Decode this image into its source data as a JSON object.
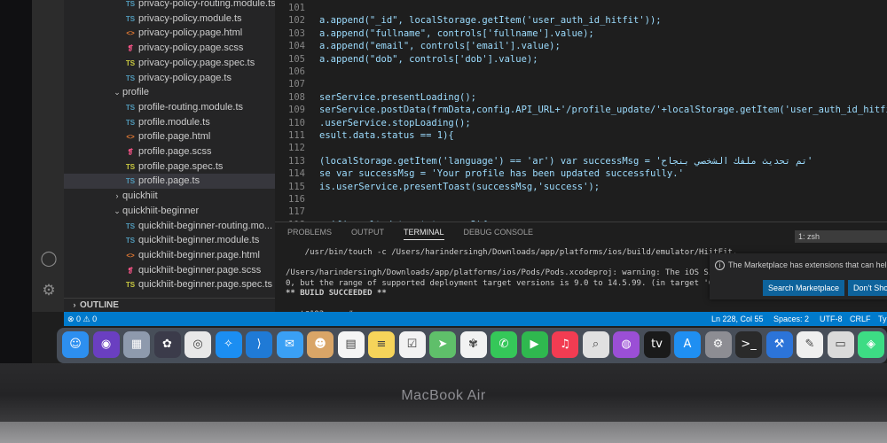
{
  "sidebar": {
    "items": [
      {
        "label": "privacy-policy-routing.module.ts",
        "icon": "TS",
        "type": "ts"
      },
      {
        "label": "privacy-policy.module.ts",
        "icon": "TS",
        "type": "ts"
      },
      {
        "label": "privacy-policy.page.html",
        "icon": "<>",
        "type": "html"
      },
      {
        "label": "privacy-policy.page.scss",
        "icon": "❡",
        "type": "scss"
      },
      {
        "label": "privacy-policy.page.spec.ts",
        "icon": "TS",
        "type": "spec"
      },
      {
        "label": "privacy-policy.page.ts",
        "icon": "TS",
        "type": "ts"
      },
      {
        "label": "profile",
        "icon": "⌄",
        "type": "folder-open"
      },
      {
        "label": "profile-routing.module.ts",
        "icon": "TS",
        "type": "ts"
      },
      {
        "label": "profile.module.ts",
        "icon": "TS",
        "type": "ts"
      },
      {
        "label": "profile.page.html",
        "icon": "<>",
        "type": "html"
      },
      {
        "label": "profile.page.scss",
        "icon": "❡",
        "type": "scss"
      },
      {
        "label": "profile.page.spec.ts",
        "icon": "TS",
        "type": "spec"
      },
      {
        "label": "profile.page.ts",
        "icon": "TS",
        "type": "ts",
        "selected": true
      },
      {
        "label": "quickhiit",
        "icon": "›",
        "type": "folder"
      },
      {
        "label": "quickhiit-beginner",
        "icon": "⌄",
        "type": "folder-open"
      },
      {
        "label": "quickhiit-beginner-routing.mo...",
        "icon": "TS",
        "type": "ts"
      },
      {
        "label": "quickhiit-beginner.module.ts",
        "icon": "TS",
        "type": "ts"
      },
      {
        "label": "quickhiit-beginner.page.html",
        "icon": "<>",
        "type": "html"
      },
      {
        "label": "quickhiit-beginner.page.scss",
        "icon": "❡",
        "type": "scss"
      },
      {
        "label": "quickhiit-beginner.page.spec.ts",
        "icon": "TS",
        "type": "spec"
      }
    ],
    "outline_label": "OUTLINE"
  },
  "editor": {
    "lines": [
      {
        "num": "101",
        "text": ""
      },
      {
        "num": "102",
        "text": "a.append(\"_id\", localStorage.getItem('user_auth_id_hitfit'));"
      },
      {
        "num": "103",
        "text": "a.append(\"fullname\", controls['fullname'].value);"
      },
      {
        "num": "104",
        "text": "a.append(\"email\", controls['email'].value);"
      },
      {
        "num": "105",
        "text": "a.append(\"dob\", controls['dob'].value);"
      },
      {
        "num": "106",
        "text": ""
      },
      {
        "num": "107",
        "text": ""
      },
      {
        "num": "108",
        "text": "serService.presentLoading();"
      },
      {
        "num": "109",
        "text": "serService.postData(frmData,config.API_URL+'/profile_update/'+localStorage.getItem('user_auth_id_hitfit')).subscribe((result) => {"
      },
      {
        "num": "110",
        "text": ".userService.stopLoading();"
      },
      {
        "num": "111",
        "text": "esult.data.status == 1){"
      },
      {
        "num": "112",
        "text": ""
      },
      {
        "num": "113",
        "text": "(localStorage.getItem('language') == 'ar') var successMsg = 'تم تحديث ملفك الشخصي بنجاح'"
      },
      {
        "num": "114",
        "text": "se var successMsg = 'Your profile has been updated successfully.'"
      },
      {
        "num": "115",
        "text": "is.userService.presentToast(successMsg,'success');"
      },
      {
        "num": "116",
        "text": ""
      },
      {
        "num": "117",
        "text": ""
      },
      {
        "num": "118",
        "text": "  if(result.data.status == 2){"
      }
    ]
  },
  "panel": {
    "tabs": [
      "PROBLEMS",
      "OUTPUT",
      "TERMINAL",
      "DEBUG CONSOLE"
    ],
    "active_tab": "TERMINAL",
    "terminal_select": "1: zsh",
    "terminal_lines": [
      "    /usr/bin/touch -c /Users/harindersingh/Downloads/app/platforms/ios/build/emulator/HiitFit.",
      "",
      "/Users/harindersingh/Downloads/app/platforms/ios/Pods/Pods.xcodeproj: warning: The iOS Simulat",
      "0, but the range of supported deployment target versions is 9.0 to 14.5.99. (in target 'Google",
      "** BUILD SUCCEEDED **",
      "",
      "root@192 app # ▯"
    ]
  },
  "notification": {
    "message": "The Marketplace has extensions that can help with",
    "search_button": "Search Marketplace",
    "dismiss_button": "Don't Show Again"
  },
  "statusbar": {
    "problems": "⊗ 0 ⚠ 0",
    "position": "Ln 228, Col 55",
    "spaces": "Spaces: 2",
    "encoding": "UTF-8",
    "eol": "CRLF",
    "language": "TypeScript"
  },
  "dock": {
    "apps": [
      {
        "name": "Finder",
        "color": "#2d8ff0",
        "glyph": "☺"
      },
      {
        "name": "Siri",
        "color": "#6a3fc1",
        "glyph": "◉"
      },
      {
        "name": "Launchpad",
        "color": "#8e9aad",
        "glyph": "▦"
      },
      {
        "name": "DaVinci Resolve",
        "color": "#3b3b4a",
        "glyph": "✿"
      },
      {
        "name": "Chrome",
        "color": "#e8e8e8",
        "glyph": "◎"
      },
      {
        "name": "Safari",
        "color": "#1b8ef2",
        "glyph": "✧"
      },
      {
        "name": "VS Code",
        "color": "#1f7ad6",
        "glyph": "⟩"
      },
      {
        "name": "Mail",
        "color": "#3aa0f5",
        "glyph": "✉"
      },
      {
        "name": "Contacts",
        "color": "#d9a567",
        "glyph": "☻"
      },
      {
        "name": "Calendar",
        "color": "#f5f5f5",
        "glyph": "▤"
      },
      {
        "name": "Notes",
        "color": "#f6d45a",
        "glyph": "≡"
      },
      {
        "name": "Reminders",
        "color": "#f2f2f2",
        "glyph": "☑"
      },
      {
        "name": "Maps",
        "color": "#5fbf6a",
        "glyph": "➤"
      },
      {
        "name": "Photos",
        "color": "#f2f2f2",
        "glyph": "✾"
      },
      {
        "name": "Messages",
        "color": "#35c759",
        "glyph": "✆"
      },
      {
        "name": "FaceTime",
        "color": "#2fb84f",
        "glyph": "▶"
      },
      {
        "name": "Music",
        "color": "#f23c52",
        "glyph": "♫"
      },
      {
        "name": "Preview",
        "color": "#e0e0e0",
        "glyph": "⌕"
      },
      {
        "name": "Podcasts",
        "color": "#9b4fd6",
        "glyph": "◍"
      },
      {
        "name": "TV",
        "color": "#1a1a1a",
        "glyph": "tv"
      },
      {
        "name": "App Store",
        "color": "#1f8ff2",
        "glyph": "A"
      },
      {
        "name": "System Preferences",
        "color": "#8d8d93",
        "glyph": "⚙"
      },
      {
        "name": "Terminal",
        "color": "#2a2a2a",
        "glyph": ">_"
      },
      {
        "name": "Xcode",
        "color": "#2c74d9",
        "glyph": "⚒"
      },
      {
        "name": "TextEdit",
        "color": "#efefef",
        "glyph": "✎"
      },
      {
        "name": "Simulator",
        "color": "#dadada",
        "glyph": "▭"
      },
      {
        "name": "Android Studio",
        "color": "#3ddc84",
        "glyph": "◈"
      }
    ]
  },
  "laptop": {
    "brand": "MacBook Air"
  }
}
